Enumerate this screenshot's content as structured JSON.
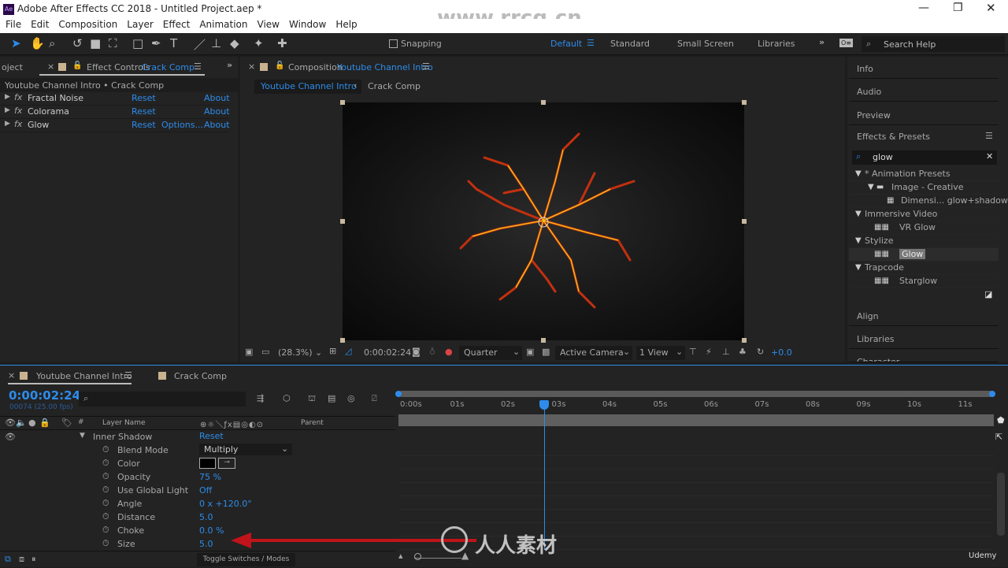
{
  "window": {
    "title": "Adobe After Effects CC 2018 - Untitled Project.aep *",
    "app_icon": "Ae",
    "watermark": "www.rrcg.cn"
  },
  "menu": [
    "File",
    "Edit",
    "Composition",
    "Layer",
    "Effect",
    "Animation",
    "View",
    "Window",
    "Help"
  ],
  "toolbar": {
    "snapping": "Snapping",
    "workspaces": [
      "Default",
      "Standard",
      "Small Screen",
      "Libraries"
    ],
    "search_placeholder": "Search Help"
  },
  "effect_controls": {
    "project_tab": "oject",
    "tab_label": "Effect Controls",
    "tab_comp": "Crack Comp",
    "breadcrumb": "Youtube Channel Intro • Crack Comp",
    "effects": [
      {
        "name": "Fractal Noise",
        "reset": "Reset",
        "options": "",
        "about": "About"
      },
      {
        "name": "Colorama",
        "reset": "Reset",
        "options": "",
        "about": "About"
      },
      {
        "name": "Glow",
        "reset": "Reset",
        "options": "Options...",
        "about": "About"
      }
    ]
  },
  "composition": {
    "tab_label": "Composition",
    "tab_comp": "Youtube Channel Intro",
    "nav": [
      "Youtube Channel Intro",
      "Crack Comp"
    ],
    "footer": {
      "zoom": "(28.3%)",
      "timecode": "0:00:02:24",
      "resolution": "Quarter",
      "camera": "Active Camera",
      "views": "1 View",
      "exposure": "+0.0"
    }
  },
  "right_panels": {
    "top": [
      "Info",
      "Audio",
      "Preview"
    ],
    "effects_presets": {
      "title": "Effects & Presets",
      "search": "glow",
      "tree": [
        {
          "label": "* Animation Presets",
          "level": 0,
          "type": "group"
        },
        {
          "label": "Image - Creative",
          "level": 1,
          "type": "folder"
        },
        {
          "label": "Dimensi... glow+shadow",
          "level": 2,
          "type": "preset"
        },
        {
          "label": "Immersive Video",
          "level": 0,
          "type": "group"
        },
        {
          "label": "VR Glow",
          "level": 1,
          "type": "effect"
        },
        {
          "label": "Stylize",
          "level": 0,
          "type": "group"
        },
        {
          "label": "Glow",
          "level": 1,
          "type": "effect",
          "selected": true
        },
        {
          "label": "Trapcode",
          "level": 0,
          "type": "group"
        },
        {
          "label": "Starglow",
          "level": 1,
          "type": "effect"
        }
      ]
    },
    "bottom": [
      "Align",
      "Libraries",
      "Character"
    ]
  },
  "timeline": {
    "tabs": [
      "Youtube Channel Intro",
      "Crack Comp"
    ],
    "timecode": "0:00:02:24",
    "frame_info": "00074 (25.00 fps)",
    "columns": {
      "layer_name": "Layer Name",
      "parent": "Parent",
      "num": "#"
    },
    "ruler": [
      "0:00s",
      "01s",
      "02s",
      "03s",
      "04s",
      "05s",
      "06s",
      "07s",
      "08s",
      "09s",
      "10s",
      "11s"
    ],
    "current_time_seconds": 2.96,
    "section": {
      "name": "Inner Shadow",
      "reset": "Reset"
    },
    "properties": [
      {
        "name": "Blend Mode",
        "value": "Multiply"
      },
      {
        "name": "Color",
        "value": "",
        "color": "#000000"
      },
      {
        "name": "Opacity",
        "value": "75 %"
      },
      {
        "name": "Use Global Light",
        "value": "Off"
      },
      {
        "name": "Angle",
        "value": "0 x +120.0°"
      },
      {
        "name": "Distance",
        "value": "5.0"
      },
      {
        "name": "Choke",
        "value": "0.0 %"
      },
      {
        "name": "Size",
        "value": "5.0"
      }
    ],
    "toggle_label": "Toggle Switches / Modes"
  },
  "branding": {
    "watermark_center": "人人素材",
    "udemy": "Udemy"
  },
  "colors": {
    "accent": "#2d8ceb",
    "panel": "#232323",
    "arrow": "#c0141a"
  }
}
